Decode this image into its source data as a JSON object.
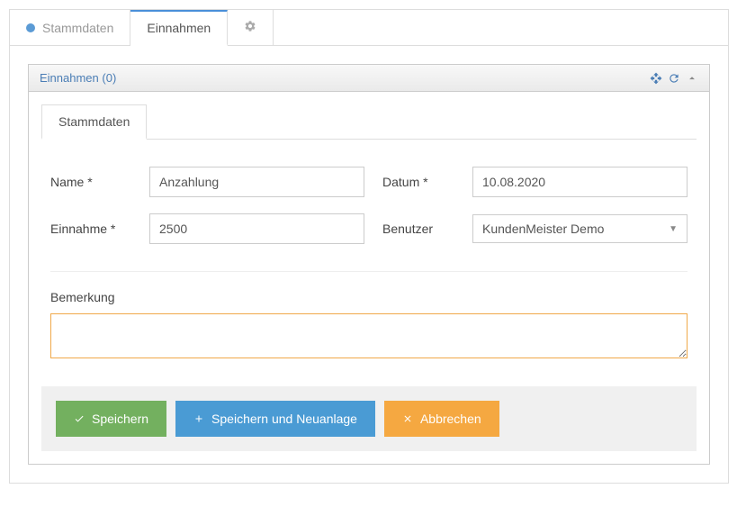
{
  "main_tabs": {
    "stammdaten": "Stammdaten",
    "einnahmen": "Einnahmen"
  },
  "panel": {
    "title": "Einnahmen (0)"
  },
  "sub_tabs": {
    "stammdaten": "Stammdaten"
  },
  "form": {
    "name_label": "Name *",
    "name_value": "Anzahlung",
    "datum_label": "Datum *",
    "datum_value": "10.08.2020",
    "einnahme_label": "Einnahme *",
    "einnahme_value": "2500",
    "benutzer_label": "Benutzer",
    "benutzer_value": "KundenMeister Demo",
    "bemerkung_label": "Bemerkung",
    "bemerkung_value": ""
  },
  "buttons": {
    "save": "Speichern",
    "save_new": "Speichern und Neuanlage",
    "cancel": "Abbrechen"
  }
}
